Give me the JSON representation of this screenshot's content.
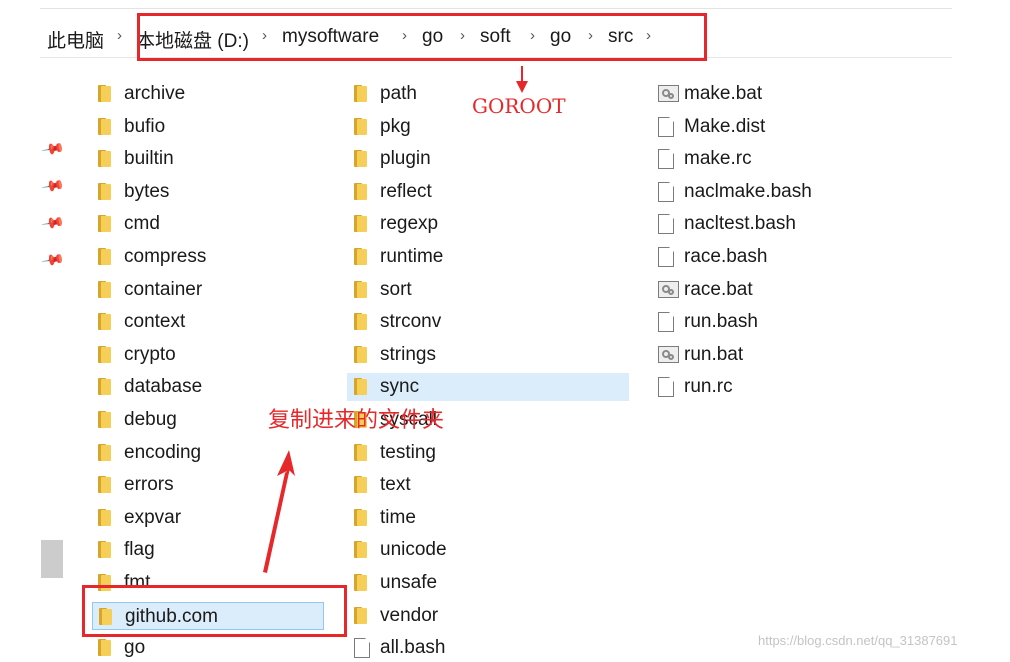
{
  "breadcrumb": {
    "segments": [
      "此电脑",
      "本地磁盘 (D:)",
      "mysoftware",
      "go",
      "soft",
      "go",
      "src"
    ],
    "separator": "›"
  },
  "columns": {
    "col1": [
      {
        "name": "archive",
        "type": "folder"
      },
      {
        "name": "bufio",
        "type": "folder"
      },
      {
        "name": "builtin",
        "type": "folder"
      },
      {
        "name": "bytes",
        "type": "folder"
      },
      {
        "name": "cmd",
        "type": "folder"
      },
      {
        "name": "compress",
        "type": "folder"
      },
      {
        "name": "container",
        "type": "folder"
      },
      {
        "name": "context",
        "type": "folder"
      },
      {
        "name": "crypto",
        "type": "folder"
      },
      {
        "name": "database",
        "type": "folder"
      },
      {
        "name": "debug",
        "type": "folder"
      },
      {
        "name": "encoding",
        "type": "folder"
      },
      {
        "name": "errors",
        "type": "folder"
      },
      {
        "name": "expvar",
        "type": "folder"
      },
      {
        "name": "flag",
        "type": "folder"
      },
      {
        "name": "fmt",
        "type": "folder"
      },
      {
        "name": "github.com",
        "type": "folder",
        "selected": true
      },
      {
        "name": "go",
        "type": "folder"
      }
    ],
    "col2": [
      {
        "name": "path",
        "type": "folder"
      },
      {
        "name": "pkg",
        "type": "folder"
      },
      {
        "name": "plugin",
        "type": "folder"
      },
      {
        "name": "reflect",
        "type": "folder"
      },
      {
        "name": "regexp",
        "type": "folder"
      },
      {
        "name": "runtime",
        "type": "folder"
      },
      {
        "name": "sort",
        "type": "folder"
      },
      {
        "name": "strconv",
        "type": "folder"
      },
      {
        "name": "strings",
        "type": "folder"
      },
      {
        "name": "sync",
        "type": "folder",
        "hover": true
      },
      {
        "name": "syscall",
        "type": "folder"
      },
      {
        "name": "testing",
        "type": "folder"
      },
      {
        "name": "text",
        "type": "folder"
      },
      {
        "name": "time",
        "type": "folder"
      },
      {
        "name": "unicode",
        "type": "folder"
      },
      {
        "name": "unsafe",
        "type": "folder"
      },
      {
        "name": "vendor",
        "type": "folder"
      },
      {
        "name": "all.bash",
        "type": "file"
      }
    ],
    "col3": [
      {
        "name": "make.bat",
        "type": "bat"
      },
      {
        "name": "Make.dist",
        "type": "file"
      },
      {
        "name": "make.rc",
        "type": "file"
      },
      {
        "name": "naclmake.bash",
        "type": "file"
      },
      {
        "name": "nacltest.bash",
        "type": "file"
      },
      {
        "name": "race.bash",
        "type": "file"
      },
      {
        "name": "race.bat",
        "type": "bat"
      },
      {
        "name": "run.bash",
        "type": "file"
      },
      {
        "name": "run.bat",
        "type": "bat"
      },
      {
        "name": "run.rc",
        "type": "file"
      }
    ]
  },
  "annotations": {
    "goroot_label": "GOROOT",
    "copied_label": "复制进来的文件夹",
    "color": "#e6282a"
  },
  "icons": {
    "pin": "pin-icon",
    "folder": "folder-icon",
    "file": "file-icon",
    "bat": "batch-file-icon"
  },
  "watermark": "https://blog.csdn.net/qq_31387691"
}
